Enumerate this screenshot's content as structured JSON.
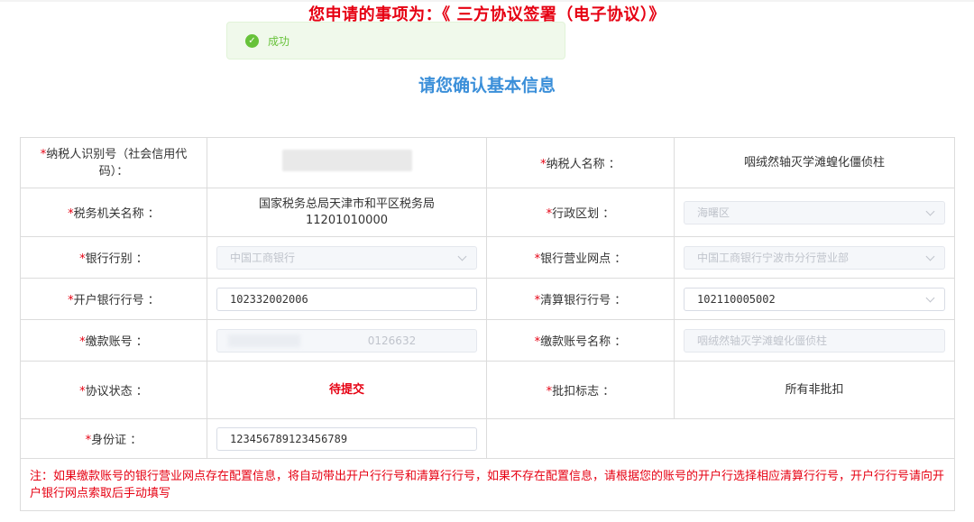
{
  "header": {
    "title": "您申请的事项为：《 三方协议签署（电子协议）》",
    "success_text": "成功",
    "confirm_heading": "请您确认基本信息"
  },
  "form": {
    "required_mark": "*",
    "taxpayer_id_label": "纳税人识别号（社会信用代码）：",
    "taxpayer_name_label": "纳税人名称 ：",
    "taxpayer_name_value": "咽绒然轴灭学滩蝗化僵侦柱",
    "tax_office_label": "税务机关名称 ：",
    "tax_office_name": "国家税务总局天津市和平区税务局",
    "tax_office_code": "11201010000",
    "district_label": "行政区划 ：",
    "district_value": "海曙区",
    "bank_type_label": "银行行别 ：",
    "bank_type_value": "中国工商银行",
    "bank_branch_label": "银行营业网点 ：",
    "bank_branch_value": "中国工商银行宁波市分行营业部",
    "open_bank_no_label": "开户银行行号 ：",
    "open_bank_no_value": "102332002006",
    "clearing_bank_no_label": "清算银行行号 ：",
    "clearing_bank_no_value": "102110005002",
    "account_label": "缴款账号 ：",
    "account_value": "0126632",
    "account_name_label": "缴款账号名称 ：",
    "account_name_value": "咽绒然轴灭学滩蝗化僵侦柱",
    "agreement_status_label": "协议状态 ：",
    "agreement_status_value": "待提交",
    "batch_flag_label": "批扣标志 ：",
    "batch_flag_value": "所有非批扣",
    "id_card_label": "身份证 ：",
    "id_card_value": "123456789123456789",
    "note": "注：如果缴款账号的银行营业网点存在配置信息，将自动带出开户行行号和清算行行号，如果不存在配置信息，请根据您的账号的开户行选择相应清算行行号，开户行行号请向开户银行网点索取后手动填写"
  },
  "colors": {
    "required": "#e60012",
    "success": "#67c23a",
    "heading_blue": "#3b8fd9"
  },
  "icons": {
    "success": "check-circle-icon",
    "dropdown": "chevron-down-icon"
  }
}
